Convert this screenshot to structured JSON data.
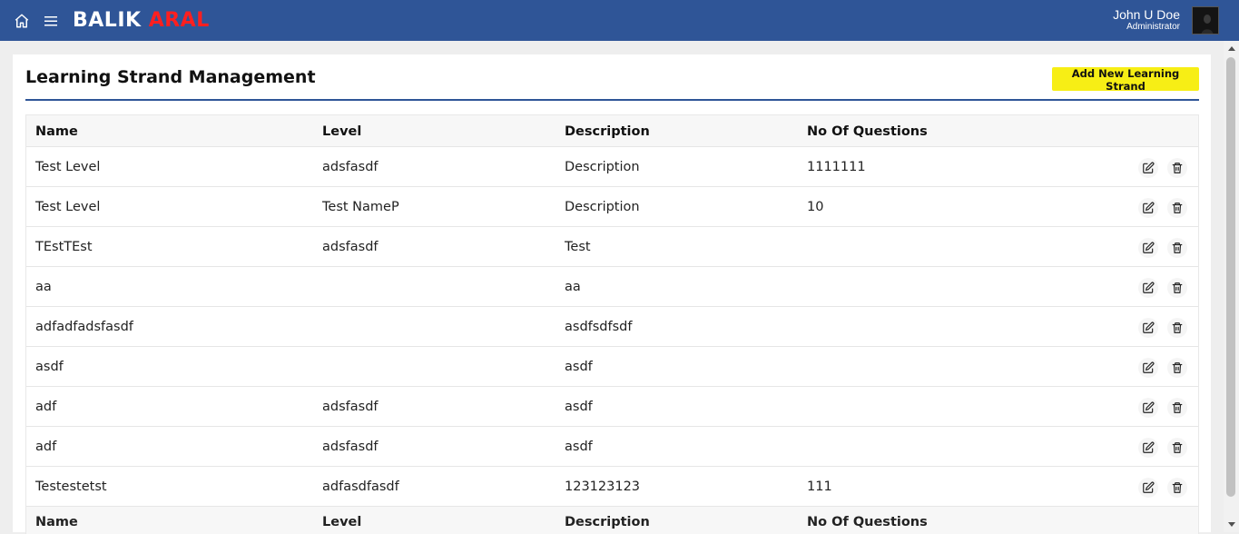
{
  "header": {
    "brand_part1": "BALIK",
    "brand_part2": "ARAL",
    "user_name": "John U Doe",
    "user_role": "Administrator"
  },
  "page": {
    "title": "Learning Strand Management",
    "add_button_label": "Add New Learning Strand"
  },
  "table": {
    "columns": [
      "Name",
      "Level",
      "Description",
      "No Of Questions"
    ],
    "rows": [
      {
        "name": "Test Level",
        "level": "adsfasdf",
        "description": "Description",
        "questions": "1111111"
      },
      {
        "name": "Test Level",
        "level": "Test NameP",
        "description": "Description",
        "questions": "10"
      },
      {
        "name": "TEstTEst",
        "level": "adsfasdf",
        "description": "Test",
        "questions": ""
      },
      {
        "name": "aa",
        "level": "",
        "description": "aa",
        "questions": ""
      },
      {
        "name": "adfadfadsfasdf",
        "level": "",
        "description": "asdfsdfsdf",
        "questions": ""
      },
      {
        "name": "asdf",
        "level": "",
        "description": "asdf",
        "questions": ""
      },
      {
        "name": "adf",
        "level": "adsfasdf",
        "description": "asdf",
        "questions": ""
      },
      {
        "name": "adf",
        "level": "adsfasdf",
        "description": "asdf",
        "questions": ""
      },
      {
        "name": "Testestetst",
        "level": "adfasdfasdf",
        "description": "123123123",
        "questions": "111"
      }
    ]
  },
  "colors": {
    "header_bg": "#2f5597",
    "brand_accent": "#ff1f1f",
    "add_button_bg": "#f7ee15"
  },
  "icons": {
    "home": "home-icon",
    "menu": "hamburger-menu-icon",
    "edit": "edit-icon",
    "delete": "trash-icon"
  }
}
